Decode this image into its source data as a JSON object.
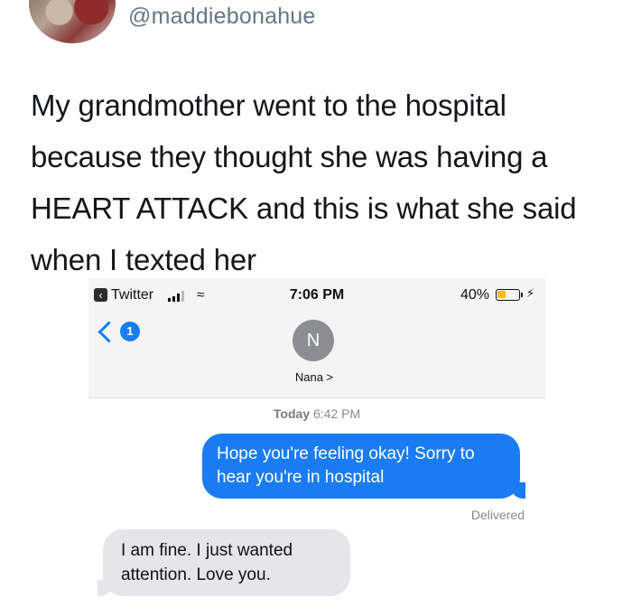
{
  "tweet": {
    "handle": "@maddiebonahue",
    "text": "My grandmother went to the hospital because they thought she was having a HEART ATTACK and this is what she said when I texted her"
  },
  "phone": {
    "status_bar": {
      "back_app": "Twitter",
      "time": "7:06 PM",
      "battery": "40%",
      "battery_level": 0.4
    },
    "nav": {
      "unread_count": "1",
      "contact_initial": "N",
      "contact_name": "Nana >"
    },
    "thread": {
      "timestamp_day": "Today",
      "timestamp_time": "6:42 PM",
      "outgoing": "Hope you're feeling okay! Sorry to hear you're in hospital",
      "delivery_status": "Delivered",
      "incoming": "I am fine. I just wanted attention. Love you."
    }
  },
  "colors": {
    "imessage_blue": "#1a7cf5",
    "incoming_gray": "#e6e6ea",
    "battery_yellow": "#f2c200"
  }
}
